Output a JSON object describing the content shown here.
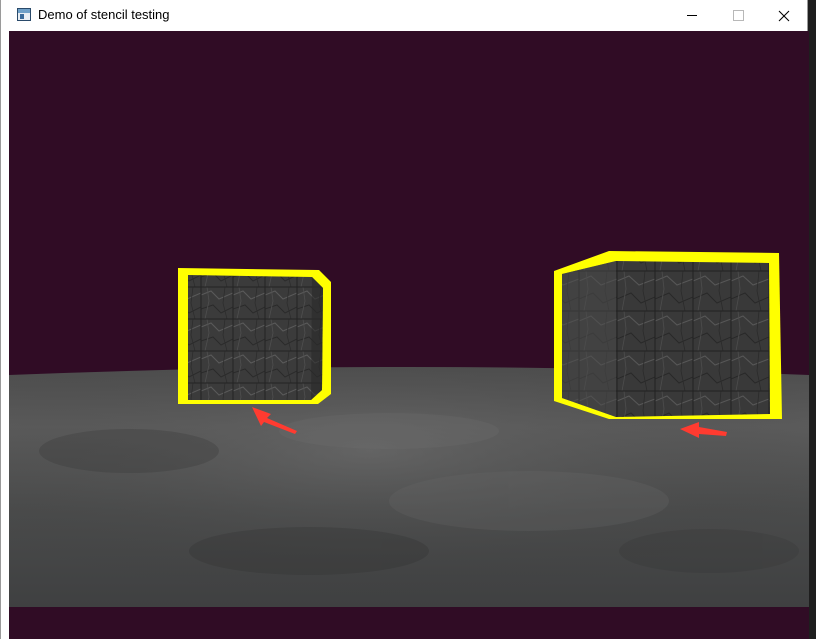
{
  "window": {
    "title": "Demo of stencil testing",
    "controls": [
      "minimize",
      "maximize",
      "close"
    ]
  },
  "scene": {
    "clear_color": "#300C25",
    "outline_color": "#FFFF00",
    "floor_color": "#5a5a5a",
    "cube_color": "#3a3a3a",
    "arrow_color": "#FF3B30",
    "objects": [
      "cube",
      "cube"
    ],
    "annotations": [
      "red-arrow",
      "red-arrow"
    ]
  },
  "icons": {
    "app": "window-app-icon",
    "minimize": "minimize-icon",
    "maximize": "maximize-icon",
    "close": "close-icon"
  }
}
